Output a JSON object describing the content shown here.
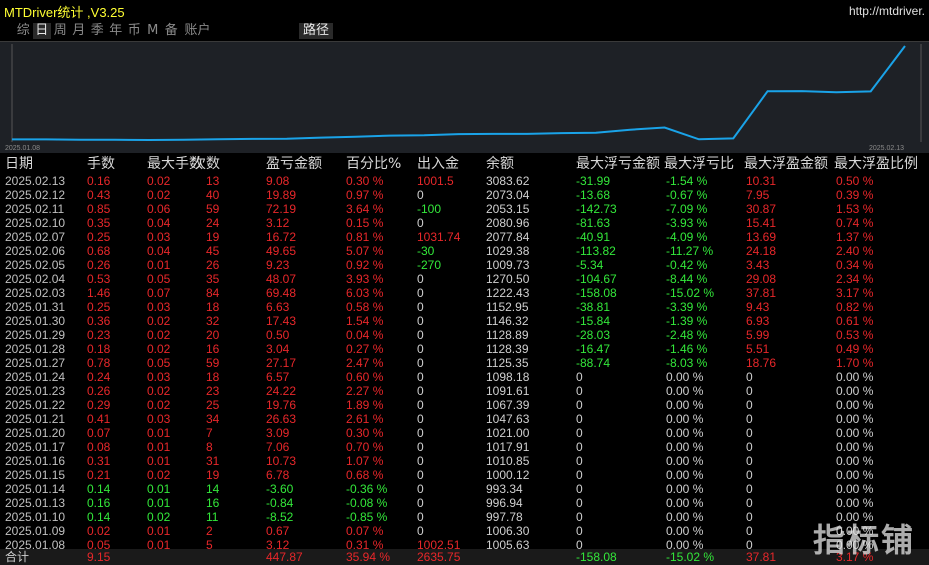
{
  "app_title": "MTDriver统计 ,V3.25",
  "url": "http://mtdriver.",
  "tabs": [
    {
      "label": "综",
      "active": false
    },
    {
      "label": "日",
      "active": true
    },
    {
      "label": "周",
      "active": false
    },
    {
      "label": "月",
      "active": false
    },
    {
      "label": "季",
      "active": false
    },
    {
      "label": "年",
      "active": false
    },
    {
      "label": "币",
      "active": false
    },
    {
      "label": "M",
      "active": false
    },
    {
      "label": "备",
      "active": false
    },
    {
      "label": "账户",
      "active": false
    }
  ],
  "extra_tab": "路径",
  "chart": {
    "start_date": "2025.01.08",
    "end_date": "2025.02.13",
    "line_color": "#1aa3e8",
    "balance": [
      1005.63,
      1006.3,
      997.78,
      996.94,
      993.34,
      1000.12,
      1010.85,
      1017.91,
      1021.0,
      1047.63,
      1067.39,
      1091.61,
      1098.18,
      1125.35,
      1128.39,
      1128.89,
      1146.32,
      1152.95,
      1222.43,
      1270.5,
      1009.73,
      1029.38,
      2077.84,
      2080.96,
      2053.15,
      2073.04,
      3083.62
    ]
  },
  "headers": [
    "日期",
    "手数",
    "最大手数",
    "次数",
    "盈亏金额",
    "百分比%",
    "出入金",
    "余额",
    "最大浮亏金额",
    "最大浮亏比",
    "最大浮盈金额",
    "最大浮盈比例"
  ],
  "rows": [
    [
      "2025.02.13",
      "0.16",
      "0.02",
      "13",
      "9.08",
      "0.30 %",
      "1001.5",
      "3083.62",
      "-31.99",
      "-1.54 %",
      "10.31",
      "0.50 %"
    ],
    [
      "2025.02.12",
      "0.43",
      "0.02",
      "40",
      "19.89",
      "0.97 %",
      "0",
      "2073.04",
      "-13.68",
      "-0.67 %",
      "7.95",
      "0.39 %"
    ],
    [
      "2025.02.11",
      "0.85",
      "0.06",
      "59",
      "72.19",
      "3.64 %",
      "-100",
      "2053.15",
      "-142.73",
      "-7.09 %",
      "30.87",
      "1.53 %"
    ],
    [
      "2025.02.10",
      "0.35",
      "0.04",
      "24",
      "3.12",
      "0.15 %",
      "0",
      "2080.96",
      "-81.63",
      "-3.93 %",
      "15.41",
      "0.74 %"
    ],
    [
      "2025.02.07",
      "0.25",
      "0.03",
      "19",
      "16.72",
      "0.81 %",
      "1031.74",
      "2077.84",
      "-40.91",
      "-4.09 %",
      "13.69",
      "1.37 %"
    ],
    [
      "2025.02.06",
      "0.68",
      "0.04",
      "45",
      "49.65",
      "5.07 %",
      "-30",
      "1029.38",
      "-113.82",
      "-11.27 %",
      "24.18",
      "2.40 %"
    ],
    [
      "2025.02.05",
      "0.26",
      "0.01",
      "26",
      "9.23",
      "0.92 %",
      "-270",
      "1009.73",
      "-5.34",
      "-0.42 %",
      "3.43",
      "0.34 %"
    ],
    [
      "2025.02.04",
      "0.53",
      "0.05",
      "35",
      "48.07",
      "3.93 %",
      "0",
      "1270.50",
      "-104.67",
      "-8.44 %",
      "29.08",
      "2.34 %"
    ],
    [
      "2025.02.03",
      "1.46",
      "0.07",
      "84",
      "69.48",
      "6.03 %",
      "0",
      "1222.43",
      "-158.08",
      "-15.02 %",
      "37.81",
      "3.17 %"
    ],
    [
      "2025.01.31",
      "0.25",
      "0.03",
      "18",
      "6.63",
      "0.58 %",
      "0",
      "1152.95",
      "-38.81",
      "-3.39 %",
      "9.43",
      "0.82 %"
    ],
    [
      "2025.01.30",
      "0.36",
      "0.02",
      "32",
      "17.43",
      "1.54 %",
      "0",
      "1146.32",
      "-15.84",
      "-1.39 %",
      "6.93",
      "0.61 %"
    ],
    [
      "2025.01.29",
      "0.23",
      "0.02",
      "20",
      "0.50",
      "0.04 %",
      "0",
      "1128.89",
      "-28.03",
      "-2.48 %",
      "5.99",
      "0.53 %"
    ],
    [
      "2025.01.28",
      "0.18",
      "0.02",
      "16",
      "3.04",
      "0.27 %",
      "0",
      "1128.39",
      "-16.47",
      "-1.46 %",
      "5.51",
      "0.49 %"
    ],
    [
      "2025.01.27",
      "0.78",
      "0.05",
      "59",
      "27.17",
      "2.47 %",
      "0",
      "1125.35",
      "-88.74",
      "-8.03 %",
      "18.76",
      "1.70 %"
    ],
    [
      "2025.01.24",
      "0.24",
      "0.03",
      "18",
      "6.57",
      "0.60 %",
      "0",
      "1098.18",
      "0",
      "0.00 %",
      "0",
      "0.00 %"
    ],
    [
      "2025.01.23",
      "0.26",
      "0.02",
      "23",
      "24.22",
      "2.27 %",
      "0",
      "1091.61",
      "0",
      "0.00 %",
      "0",
      "0.00 %"
    ],
    [
      "2025.01.22",
      "0.29",
      "0.02",
      "25",
      "19.76",
      "1.89 %",
      "0",
      "1067.39",
      "0",
      "0.00 %",
      "0",
      "0.00 %"
    ],
    [
      "2025.01.21",
      "0.41",
      "0.03",
      "34",
      "26.63",
      "2.61 %",
      "0",
      "1047.63",
      "0",
      "0.00 %",
      "0",
      "0.00 %"
    ],
    [
      "2025.01.20",
      "0.07",
      "0.01",
      "7",
      "3.09",
      "0.30 %",
      "0",
      "1021.00",
      "0",
      "0.00 %",
      "0",
      "0.00 %"
    ],
    [
      "2025.01.17",
      "0.08",
      "0.01",
      "8",
      "7.06",
      "0.70 %",
      "0",
      "1017.91",
      "0",
      "0.00 %",
      "0",
      "0.00 %"
    ],
    [
      "2025.01.16",
      "0.31",
      "0.01",
      "31",
      "10.73",
      "1.07 %",
      "0",
      "1010.85",
      "0",
      "0.00 %",
      "0",
      "0.00 %"
    ],
    [
      "2025.01.15",
      "0.21",
      "0.02",
      "19",
      "6.78",
      "0.68 %",
      "0",
      "1000.12",
      "0",
      "0.00 %",
      "0",
      "0.00 %"
    ],
    [
      "2025.01.14",
      "0.14",
      "0.01",
      "14",
      "-3.60",
      "-0.36 %",
      "0",
      "993.34",
      "0",
      "0.00 %",
      "0",
      "0.00 %"
    ],
    [
      "2025.01.13",
      "0.16",
      "0.01",
      "16",
      "-0.84",
      "-0.08 %",
      "0",
      "996.94",
      "0",
      "0.00 %",
      "0",
      "0.00 %"
    ],
    [
      "2025.01.10",
      "0.14",
      "0.02",
      "11",
      "-8.52",
      "-0.85 %",
      "0",
      "997.78",
      "0",
      "0.00 %",
      "0",
      "0.00 %"
    ],
    [
      "2025.01.09",
      "0.02",
      "0.01",
      "2",
      "0.67",
      "0.07 %",
      "0",
      "1006.30",
      "0",
      "0.00 %",
      "0",
      "0.00 %"
    ],
    [
      "2025.01.08",
      "0.05",
      "0.01",
      "5",
      "3.12",
      "0.31 %",
      "1002.51",
      "1005.63",
      "0",
      "0.00 %",
      "0",
      "0.00 %"
    ]
  ],
  "total": [
    "合计",
    "9.15",
    "",
    "",
    "447.87",
    "35.94 %",
    "2635.75",
    "",
    "-158.08",
    "-15.02 %",
    "37.81",
    "3.17 %"
  ],
  "watermark": "指标铺",
  "colors": {
    "profit": "#e8272a",
    "loss": "#33e83a",
    "neutral": "#d0d0d0",
    "title": "#ffff33"
  }
}
